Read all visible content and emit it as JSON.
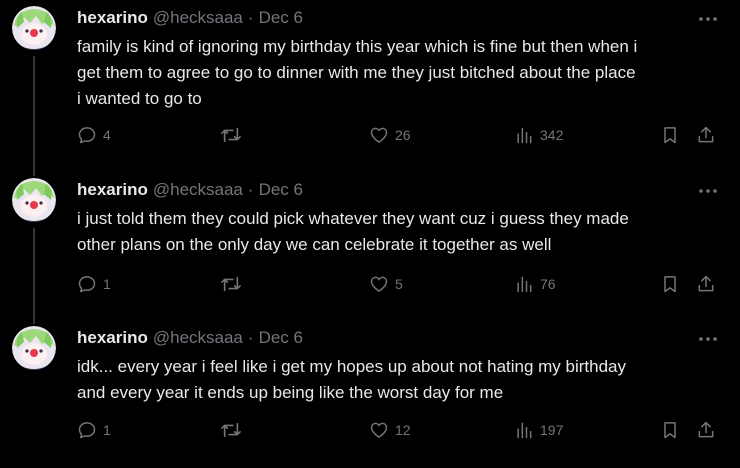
{
  "user": {
    "name": "hexarino",
    "handle": "@hecksaaa",
    "separator": "·"
  },
  "icons": {
    "reply": "reply-icon",
    "retweet": "retweet-icon",
    "like": "heart-icon",
    "views": "views-icon",
    "bookmark": "bookmark-icon",
    "share": "share-icon",
    "more": "more-icon"
  },
  "colors": {
    "background": "#000000",
    "text": "#e7e9ea",
    "muted": "#71767b",
    "thread_line": "#333639"
  },
  "tweets": [
    {
      "date": "Dec 6",
      "lines": [
        "family is kind of ignoring my birthday this year which is fine but then when i",
        "get them to agree to go to dinner with me they just bitched about the place",
        "i wanted to go to"
      ],
      "replies": "4",
      "retweets": "",
      "likes": "26",
      "views": "342"
    },
    {
      "date": "Dec 6",
      "lines": [
        "i just told them they could pick whatever they want cuz i guess they made",
        "other plans on the only day we can celebrate it together as well"
      ],
      "replies": "1",
      "retweets": "",
      "likes": "5",
      "views": "76"
    },
    {
      "date": "Dec 6",
      "lines": [
        "idk... every year i feel like i get my hopes up about not hating my birthday",
        "and every year it ends up being like the worst day for me"
      ],
      "replies": "1",
      "retweets": "",
      "likes": "12",
      "views": "197"
    }
  ]
}
